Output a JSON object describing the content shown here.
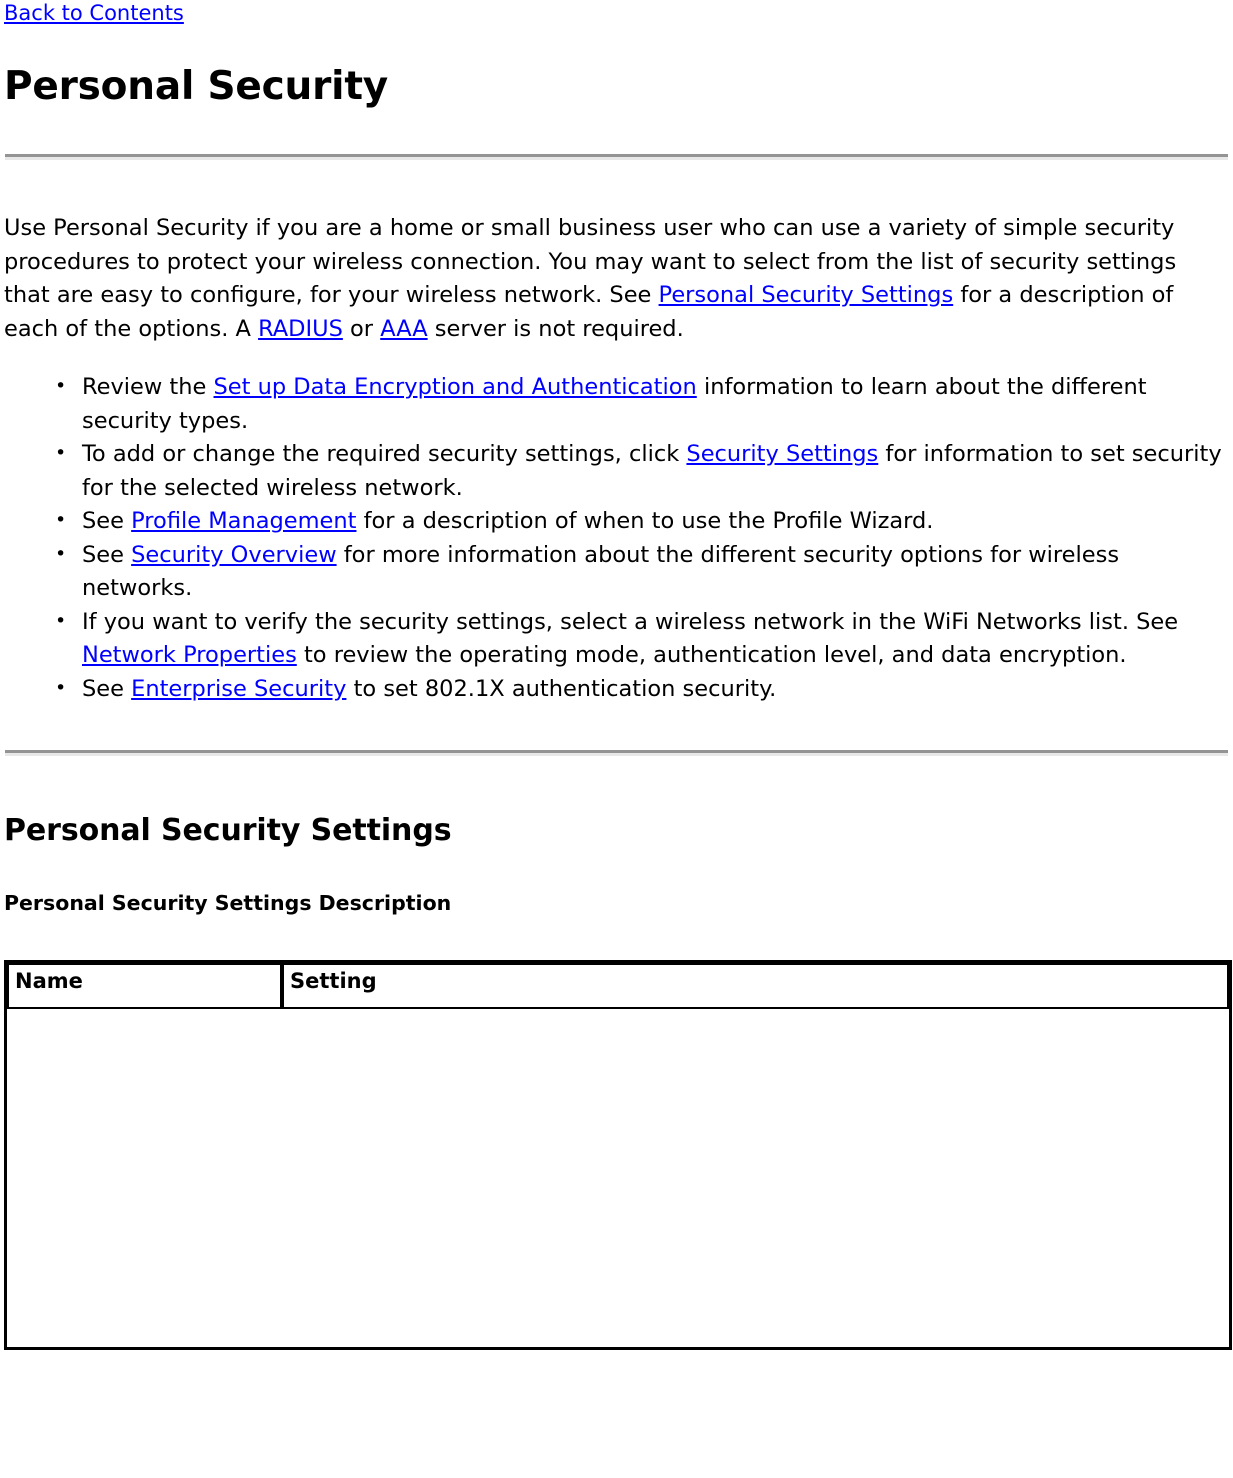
{
  "nav": {
    "back_link": "Back to Contents"
  },
  "page": {
    "title": "Personal Security"
  },
  "intro": {
    "part1": "Use Personal Security if you are a home or small business user who can use a variety of simple security procedures to protect your wireless connection. You may want to select from the list of security settings that are easy to configure, for your wireless network. See ",
    "link_personal_security_settings": "Personal Security Settings",
    "part2": " for a description of each of the options. A ",
    "link_radius": "RADIUS",
    "part3": " or ",
    "link_aaa": "AAA",
    "part4": " server is not required."
  },
  "bullets": [
    {
      "pre": "Review the ",
      "link": "Set up Data Encryption and Authentication",
      "post": " information to learn about the different security types."
    },
    {
      "pre": "To add or change the required security settings, click ",
      "link": "Security Settings",
      "post": " for information to set security for the selected wireless network."
    },
    {
      "pre": "See ",
      "link": "Profile Management",
      "post": " for a description of when to use the Profile Wizard."
    },
    {
      "pre": "See ",
      "link": "Security Overview",
      "post": " for more information about the different security options for wireless networks."
    },
    {
      "pre": "If you want to verify the security settings, select a wireless network in the WiFi Networks list. See ",
      "link": "Network Properties",
      "post": " to review the operating mode, authentication level, and data encryption."
    },
    {
      "pre": "See ",
      "link": "Enterprise Security",
      "post": " to set 802.1X authentication security."
    }
  ],
  "section": {
    "title": "Personal Security Settings",
    "table_caption": "Personal Security Settings Description"
  },
  "table": {
    "columns": [
      "Name",
      "Setting"
    ],
    "rows": []
  },
  "colors": {
    "link": "#0000FF",
    "text": "#000000",
    "rule_top": "#949494",
    "rule_bottom": "#E8E8E8",
    "table_border": "#000000",
    "background": "#FFFFFF"
  }
}
